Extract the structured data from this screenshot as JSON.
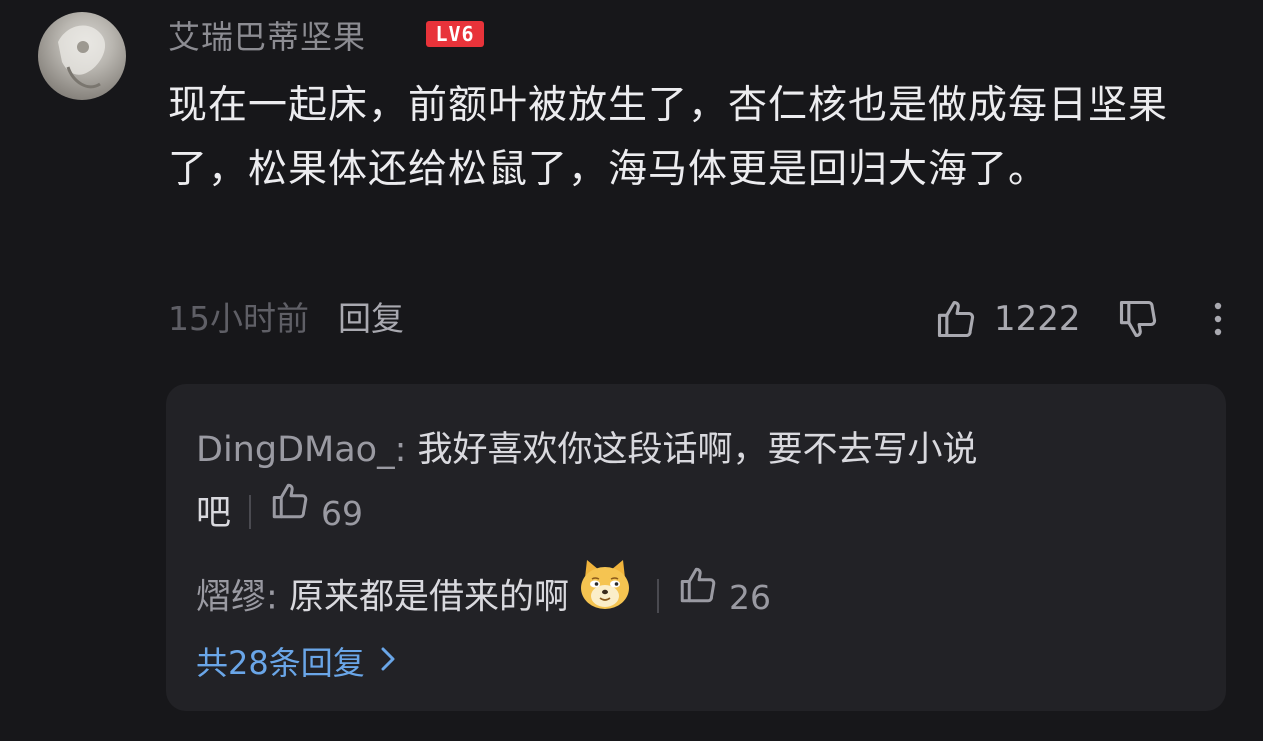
{
  "comment": {
    "username": "艾瑞巴蒂坚果",
    "level_badge": "LV6",
    "text": "现在一起床，前额叶被放生了，杏仁核也是做成每日坚果了，松果体还给松鼠了，海马体更是回归大海了。",
    "time": "15小时前",
    "reply_label": "回复",
    "like_count": "1222"
  },
  "replies": {
    "items": [
      {
        "user": "DingDMao_",
        "separator": ":",
        "text_line1": " 我好喜欢你这段话啊，要不去写小说",
        "text_line2": "吧",
        "like_count": "69"
      },
      {
        "user": "熠缪",
        "separator": ":",
        "text": " 原来都是借来的啊",
        "emoji": "doge-emoji",
        "like_count": "26"
      }
    ],
    "total_label": "共28条回复"
  },
  "colors": {
    "background": "#17171a",
    "panel": "#222226",
    "level_badge": "#e8333a",
    "link_blue": "#6aa6e8"
  }
}
